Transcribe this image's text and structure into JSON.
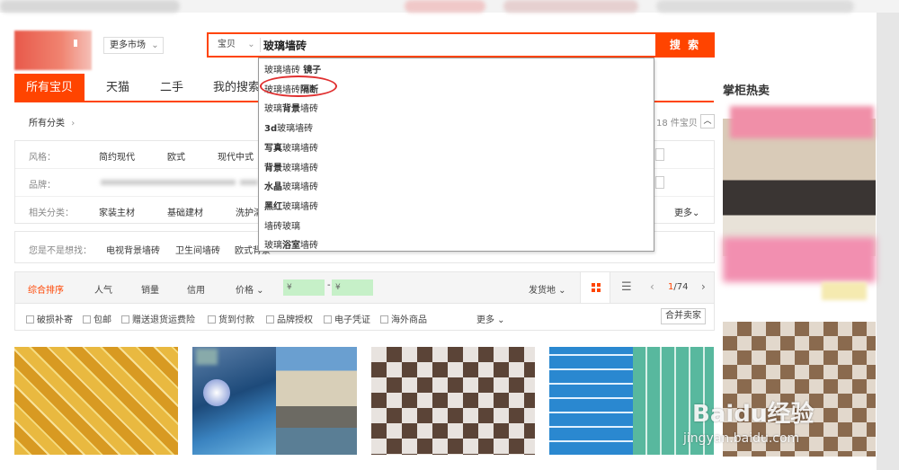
{
  "search": {
    "type_label": "宝贝",
    "query": "玻璃墙砖",
    "button_label": "搜 索"
  },
  "header": {
    "more_market": "更多市场"
  },
  "nav": {
    "tabs": [
      "所有宝贝",
      "天猫",
      "二手",
      "我的搜索"
    ],
    "side_title": "掌柜热卖"
  },
  "suggestions": [
    {
      "prefix": "玻璃墙砖 ",
      "bold": "镜子"
    },
    {
      "prefix": "玻璃墙砖",
      "bold": "隔断"
    },
    {
      "prefix": "玻璃",
      "bold": "背景",
      "suffix": "墙砖"
    },
    {
      "prefix": "",
      "bold": "3d",
      "suffix": "玻璃墙砖"
    },
    {
      "prefix": "",
      "bold": "写真",
      "suffix": "玻璃墙砖"
    },
    {
      "prefix": "",
      "bold": "背景",
      "suffix": "玻璃墙砖"
    },
    {
      "prefix": "",
      "bold": "水晶",
      "suffix": "玻璃墙砖"
    },
    {
      "prefix": "",
      "bold": "黑红",
      "suffix": "玻璃墙砖"
    },
    {
      "prefix": "墙砖玻璃",
      "bold": ""
    },
    {
      "prefix": "玻璃",
      "bold": "浴室",
      "suffix": "墙砖"
    }
  ],
  "breadcrumb": {
    "label": "所有分类",
    "count_text": "18 件宝贝"
  },
  "filters": {
    "style_label": "风格：",
    "style_items": [
      "简约现代",
      "欧式",
      "现代中式"
    ],
    "brand_label": "品牌：",
    "related_label": "相关分类：",
    "related_items": [
      "家装主材",
      "基础建材",
      "洗护清"
    ],
    "more": "更多",
    "suggest_label": "您是不是想找：",
    "suggest_items": [
      "电视背景墙砖",
      "卫生间墙砖",
      "欧式背景"
    ]
  },
  "sort": {
    "items": [
      "综合排序",
      "人气",
      "销量",
      "信用",
      "价格"
    ],
    "price_placeholder": "¥",
    "ship_from": "发货地",
    "page": "1",
    "pages": "/74"
  },
  "options": {
    "checkboxes": [
      "破损补寄",
      "包邮",
      "赠送退货运费险",
      "货到付款",
      "品牌授权",
      "电子凭证",
      "海外商品"
    ],
    "more": "更多",
    "merge_sellers": "合并卖家"
  },
  "watermark": {
    "brand": "Baidu经验",
    "url": "jingyan.baidu.com"
  },
  "colors": {
    "accent": "#ff4400",
    "highlight_circle": "#e03030"
  }
}
